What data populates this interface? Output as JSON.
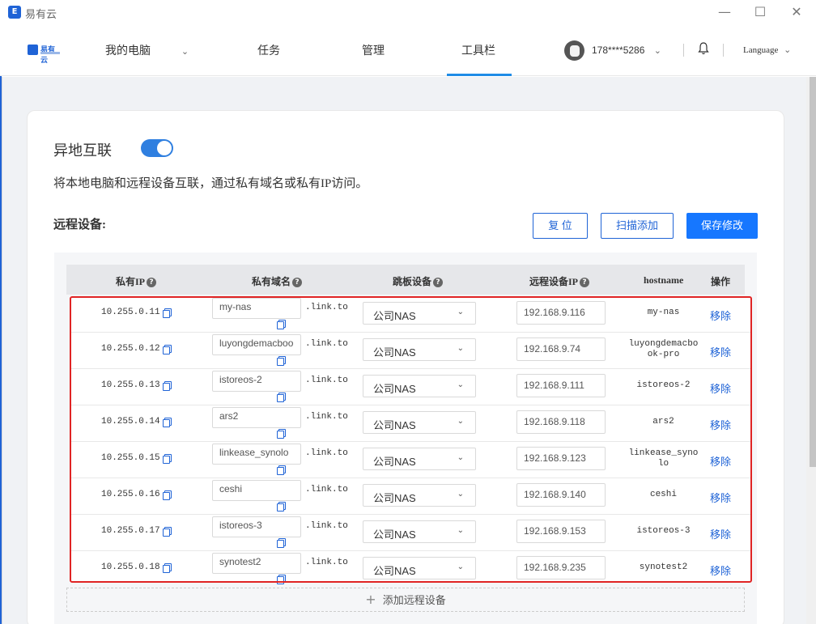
{
  "window": {
    "app_icon_letter": "E",
    "title": "易有云",
    "minimize_glyph": "—",
    "maximize_glyph": "☐",
    "close_glyph": "✕"
  },
  "nav": {
    "logo_text": "易有云",
    "items": [
      {
        "label": "我的电脑"
      },
      {
        "label": "任务"
      },
      {
        "label": "管理"
      },
      {
        "label": "工具栏"
      }
    ],
    "active": "工具栏",
    "phone": "178****5286",
    "language": "Language",
    "chevron": "⌄"
  },
  "section": {
    "title": "异地互联",
    "toggle_on": true,
    "description": "将本地电脑和远程设备互联，通过私有域名或私有IP访问。",
    "devices_label": "远程设备:"
  },
  "actions": {
    "reset": "复 位",
    "scan_add": "扫描添加",
    "save": "保存修改"
  },
  "table": {
    "headers": {
      "private_ip": "私有IP",
      "private_domain": "私有域名",
      "jump_device": "跳板设备",
      "remote_ip": "远程设备IP",
      "hostname": "hostname",
      "actions": "操作"
    },
    "help_glyph": "?",
    "domain_suffix": ".link.to",
    "select_chevron": "⌄",
    "remove_label": "移除",
    "rows": [
      {
        "ip": "10.255.0.11",
        "domain": "my-nas",
        "jump": "公司NAS",
        "remote_ip": "192.168.9.116",
        "hostname": "my-nas"
      },
      {
        "ip": "10.255.0.12",
        "domain": "luyongdemacboo",
        "jump": "公司NAS",
        "remote_ip": "192.168.9.74",
        "hostname": "luyongdemacbo\nok-pro"
      },
      {
        "ip": "10.255.0.13",
        "domain": "istoreos-2",
        "jump": "公司NAS",
        "remote_ip": "192.168.9.111",
        "hostname": "istoreos-2"
      },
      {
        "ip": "10.255.0.14",
        "domain": "ars2",
        "jump": "公司NAS",
        "remote_ip": "192.168.9.118",
        "hostname": "ars2"
      },
      {
        "ip": "10.255.0.15",
        "domain": "linkease_synolo",
        "jump": "公司NAS",
        "remote_ip": "192.168.9.123",
        "hostname": "linkease_syno\nlo"
      },
      {
        "ip": "10.255.0.16",
        "domain": "ceshi",
        "jump": "公司NAS",
        "remote_ip": "192.168.9.140",
        "hostname": "ceshi"
      },
      {
        "ip": "10.255.0.17",
        "domain": "istoreos-3",
        "jump": "公司NAS",
        "remote_ip": "192.168.9.153",
        "hostname": "istoreos-3"
      },
      {
        "ip": "10.255.0.18",
        "domain": "synotest2",
        "jump": "公司NAS",
        "remote_ip": "192.168.9.235",
        "hostname": "synotest2"
      }
    ],
    "add_label": "添加远程设备",
    "add_glyph": "+"
  },
  "colors": {
    "accent": "#1f63d6",
    "primary_button": "#1677ff",
    "highlight_box": "#e02424"
  }
}
